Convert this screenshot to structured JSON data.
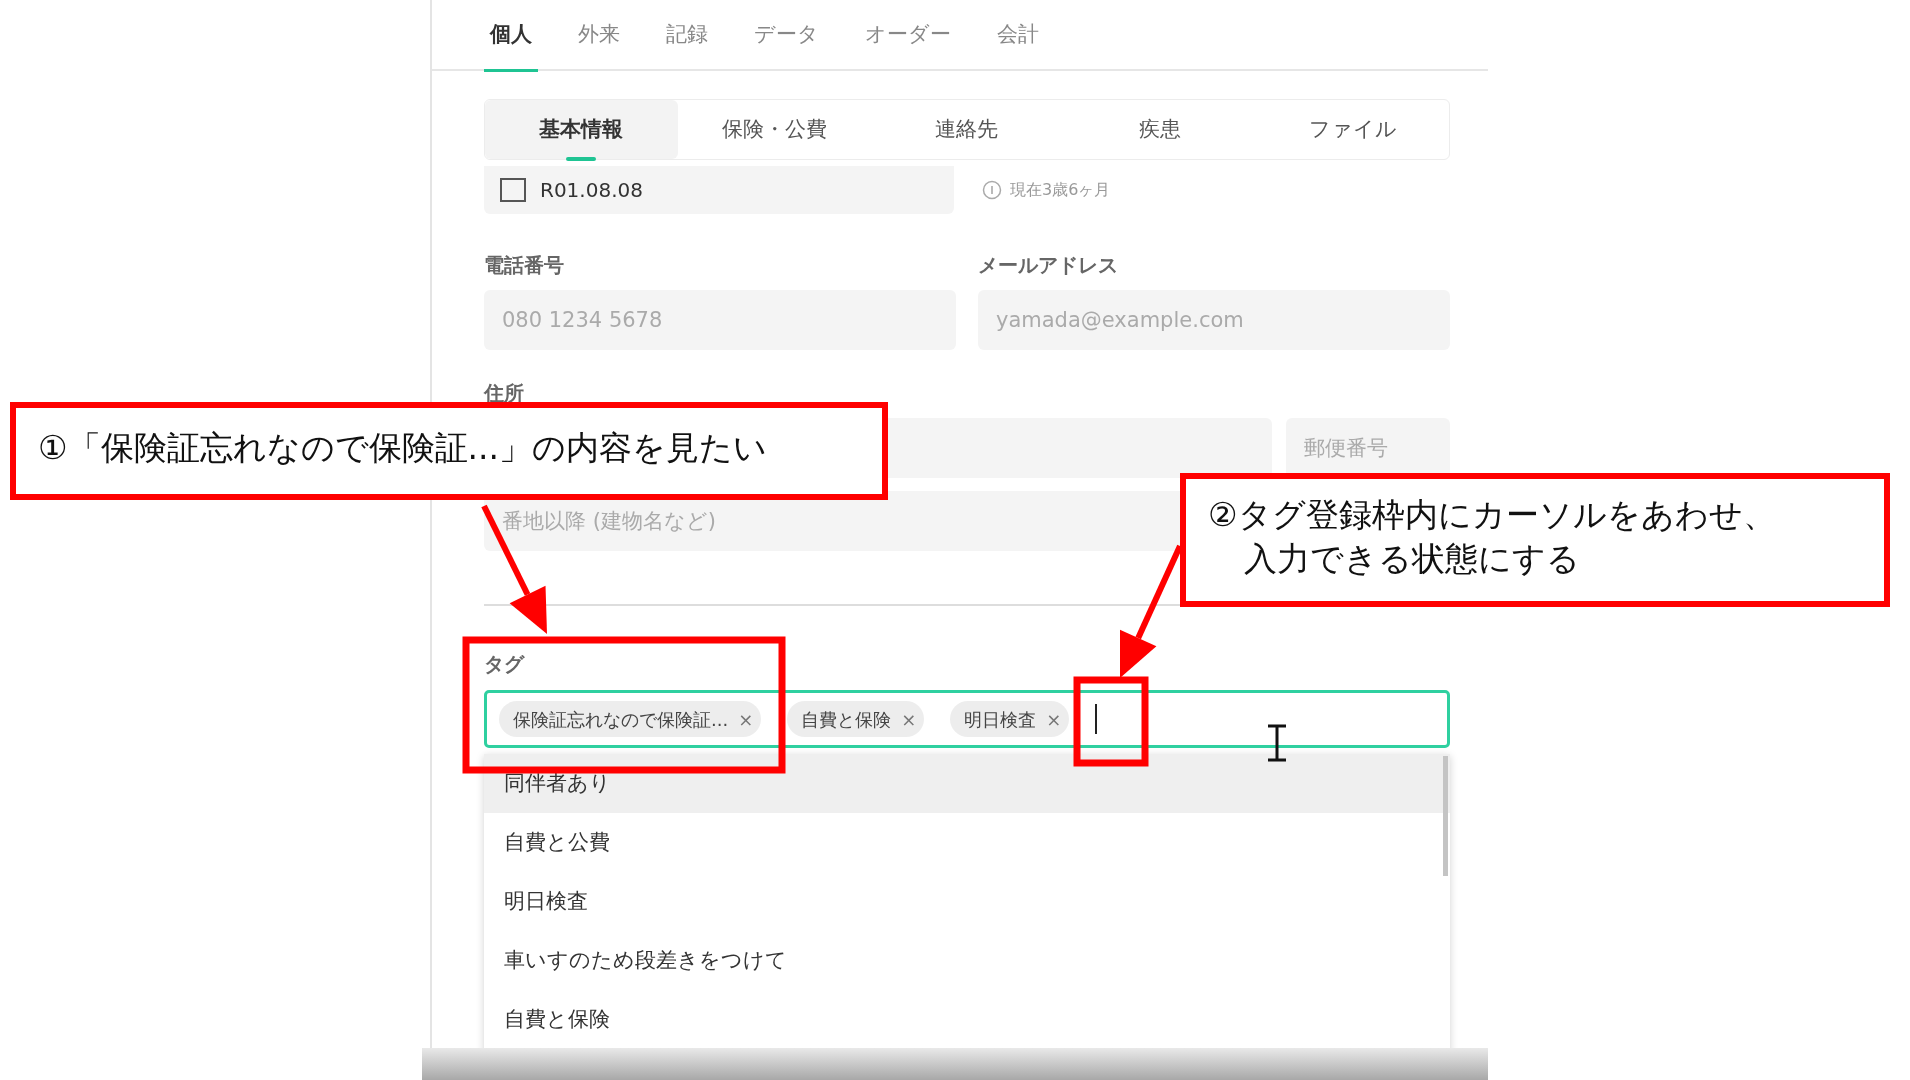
{
  "main_tabs": [
    {
      "label": "個人",
      "selected": true
    },
    {
      "label": "外来",
      "selected": false
    },
    {
      "label": "記録",
      "selected": false
    },
    {
      "label": "データ",
      "selected": false
    },
    {
      "label": "オーダー",
      "selected": false
    },
    {
      "label": "会計",
      "selected": false
    }
  ],
  "sub_tabs": [
    {
      "label": "基本情報",
      "selected": true
    },
    {
      "label": "保険・公費",
      "selected": false
    },
    {
      "label": "連絡先",
      "selected": false
    },
    {
      "label": "疾患",
      "selected": false
    },
    {
      "label": "ファイル",
      "selected": false
    }
  ],
  "birth_date": {
    "value": "R01.08.08",
    "age_note": "現在3歳6ヶ月"
  },
  "phone": {
    "label": "電話番号",
    "placeholder": "080 1234 5678"
  },
  "email": {
    "label": "メールアドレス",
    "placeholder": "yamada@example.com"
  },
  "address": {
    "label": "住所",
    "postal_placeholder": "郵便番号",
    "detail_placeholder": "番地以降 (建物名など)"
  },
  "tags": {
    "label": "タグ",
    "focused": true,
    "chips": [
      {
        "label": "保険証忘れなので保険証...",
        "remove": "×"
      },
      {
        "label": "自費と保険",
        "remove": "×"
      },
      {
        "label": "明日検査",
        "remove": "×"
      }
    ]
  },
  "suggestions": [
    {
      "label": "同伴者あり",
      "selected": true
    },
    {
      "label": "自費と公費",
      "selected": false
    },
    {
      "label": "明日検査",
      "selected": false
    },
    {
      "label": "車いすのため段差きをつけて",
      "selected": false
    },
    {
      "label": "自費と保険",
      "selected": false
    }
  ],
  "callouts": [
    {
      "lines": [
        "①「保険証忘れなので保険証...」の内容を見たい"
      ]
    },
    {
      "lines": [
        "②タグ登録枠内にカーソルをあわせ、",
        "入力できる状態にする"
      ]
    }
  ]
}
